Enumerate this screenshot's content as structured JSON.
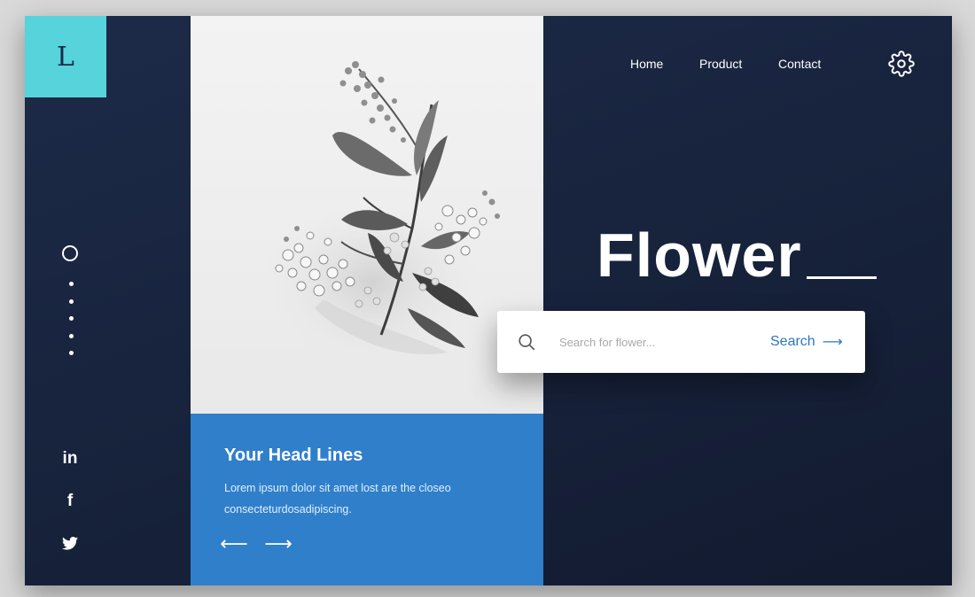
{
  "logo": {
    "letter": "L"
  },
  "nav": {
    "items": [
      {
        "label": "Home"
      },
      {
        "label": "Product"
      },
      {
        "label": "Contact"
      }
    ]
  },
  "hero": {
    "title": "Flower"
  },
  "search": {
    "placeholder": "Search for flower...",
    "button_label": "Search",
    "button_arrow": "⟶"
  },
  "card": {
    "title": "Your Head Lines",
    "text": "Lorem ipsum dolor sit amet lost are the closeo consecteturdosadipiscing.",
    "prev_arrow": "⟵",
    "next_arrow": "⟶"
  },
  "social": {
    "linkedin": "in",
    "facebook": "f"
  },
  "colors": {
    "accent_teal": "#57d3db",
    "card_blue": "#2f7fcb",
    "background_navy": "#1a2540",
    "search_blue": "#2b77c2"
  },
  "icons": [
    "settings-gear-icon",
    "search-icon",
    "linkedin-icon",
    "facebook-icon",
    "twitter-icon",
    "arrow-left-icon",
    "arrow-right-icon"
  ]
}
